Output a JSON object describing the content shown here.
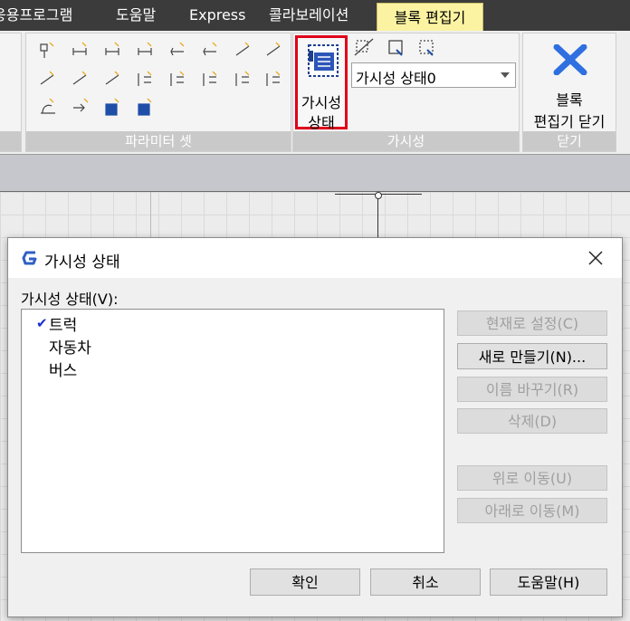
{
  "tabs": [
    "응용프로그램",
    "도움말",
    "Express",
    "콜라보레이션",
    "블록 편집기"
  ],
  "ribbon": {
    "param_panel_title": "파라미터 셋",
    "visibility_panel_title": "가시성",
    "visibility_button_label_1": "가시성",
    "visibility_button_label_2": "상태",
    "visibility_state_value": "가시성 상태0",
    "close_panel_title": "닫기",
    "close_button_label_1": "블록",
    "close_button_label_2": "편집기 닫기",
    "accent_highlight": "#e0001b",
    "close_icon_color": "#2f6fe0"
  },
  "dialog": {
    "title": "가시성 상태",
    "list_label": "가시성 상태(V):",
    "items": [
      "트럭",
      "자동차",
      "버스"
    ],
    "checked_index": 0,
    "buttons": {
      "set_current": "현재로 설정(C)",
      "new": "새로 만들기(N)...",
      "rename": "이름 바꾸기(R)",
      "delete": "삭제(D)",
      "move_up": "위로 이동(U)",
      "move_down": "아래로 이동(M)"
    },
    "footer": {
      "ok": "확인",
      "cancel": "취소",
      "help": "도움말(H)"
    }
  }
}
